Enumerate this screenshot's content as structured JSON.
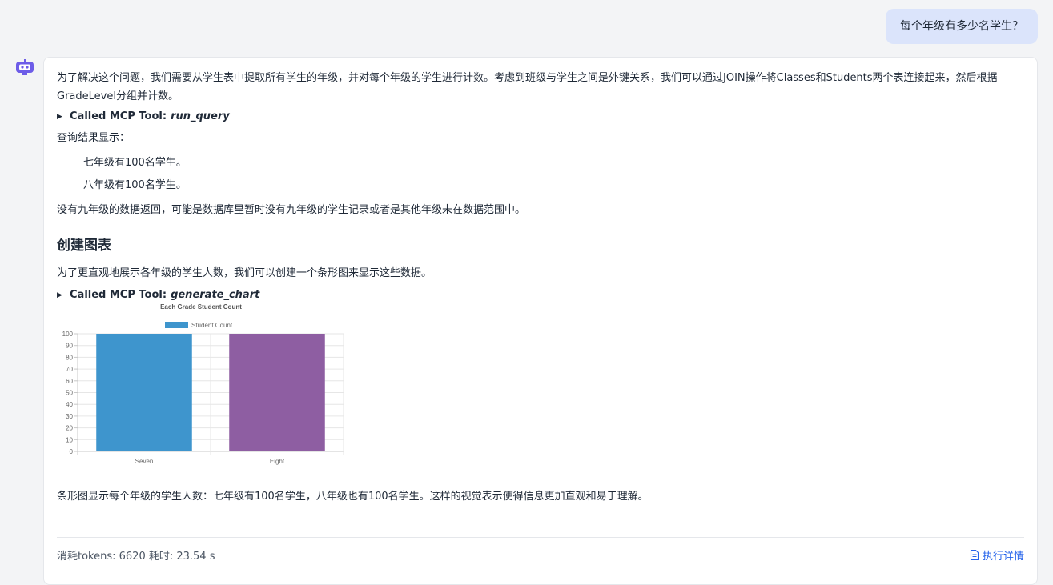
{
  "user_message": "每个年级有多少名学生？",
  "answer": {
    "intro": "为了解决这个问题，我们需要从学生表中提取所有学生的年级，并对每个年级的学生进行计数。考虑到班级与学生之间是外键关系，我们可以通过JOIN操作将Classes和Students两个表连接起来，然后根据GradeLevel分组并计数。",
    "tool1_prefix": "Called MCP Tool:",
    "tool1_name": "run_query",
    "result_heading": "查询结果显示：",
    "results": [
      "七年级有100名学生。",
      "八年级有100名学生。"
    ],
    "note": "没有九年级的数据返回，可能是数据库里暂时没有九年级的学生记录或者是其他年级未在数据范围中。",
    "section_title": "创建图表",
    "chart_intro": "为了更直观地展示各年级的学生人数，我们可以创建一个条形图来显示这些数据。",
    "tool2_prefix": "Called MCP Tool:",
    "tool2_name": "generate_chart",
    "summary": "条形图显示每个年级的学生人数：七年级有100名学生，八年级也有100名学生。这样的视觉表示使得信息更加直观和易于理解。"
  },
  "footer": {
    "stats": "消耗tokens: 6620  耗时: 23.54 s",
    "details_link": "执行详情"
  },
  "chart_data": {
    "type": "bar",
    "title": "Each Grade Student Count",
    "categories": [
      "Seven",
      "Eight"
    ],
    "series": [
      {
        "name": "Student Count",
        "values": [
          100,
          100
        ]
      }
    ],
    "bar_colors": [
      "#3e95cd",
      "#8e5ea2"
    ],
    "ylim": [
      0,
      100
    ],
    "yticks": [
      0,
      10,
      20,
      30,
      40,
      50,
      60,
      70,
      80,
      90,
      100
    ],
    "grid": true,
    "legend": "top"
  },
  "colors": {
    "accent": "#2563eb",
    "user_bubble": "#dbe4fb",
    "bot_icon": "#6d5ce8"
  }
}
